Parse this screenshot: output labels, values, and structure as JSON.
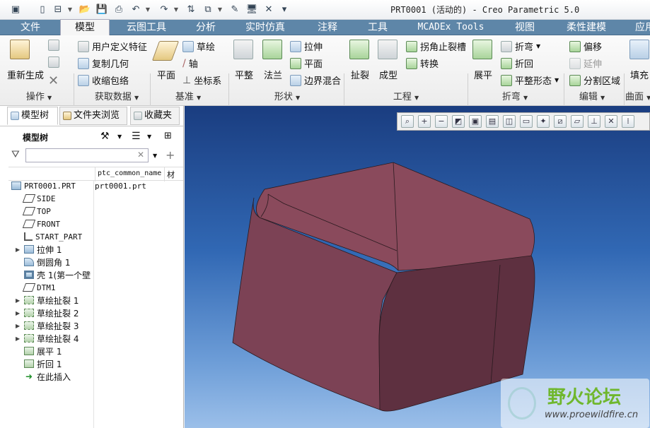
{
  "window": {
    "title": "PRT0001 (活动的) - Creo Parametric 5.0"
  },
  "quick_access": [
    "new-icon",
    "open-icon",
    "save-icon",
    "regenerate-icon",
    "undo-icon",
    "redo-icon",
    "window-icon",
    "close-icon"
  ],
  "tabs": [
    {
      "label": "文件",
      "active": false
    },
    {
      "label": "模型",
      "active": true
    },
    {
      "label": "云图工具",
      "active": false
    },
    {
      "label": "分析",
      "active": false
    },
    {
      "label": "实时仿真",
      "active": false
    },
    {
      "label": "注释",
      "active": false
    },
    {
      "label": "工具",
      "active": false
    },
    {
      "label": "MCADEx Tools",
      "active": false
    },
    {
      "label": "视图",
      "active": false
    },
    {
      "label": "柔性建模",
      "active": false
    },
    {
      "label": "应用",
      "active": false
    }
  ],
  "ribbon": {
    "operations": {
      "regenerate": "重新生成",
      "group": "操作"
    },
    "get_data": {
      "user_feature": "用户定义特征",
      "copy_geom": "复制几何",
      "shrinkwrap": "收缩包络",
      "group": "获取数据"
    },
    "datum": {
      "plane": "平面",
      "sketch": "草绘",
      "axis": "轴",
      "csys": "坐标系",
      "group": "基准"
    },
    "shapes": {
      "flat": "平整",
      "flange": "法兰",
      "extrude": "拉伸",
      "planar": "平面",
      "boundary_blend": "边界混合",
      "group": "形状"
    },
    "engineering": {
      "rip": "扯裂",
      "form": "成型",
      "corner_relief": "拐角止裂槽",
      "convert": "转换",
      "group": "工程"
    },
    "bends": {
      "unbend": "展平",
      "bend": "折弯",
      "bend_back": "折回",
      "flatten_form": "平整形态",
      "group": "折弯"
    },
    "editing": {
      "offset": "偏移",
      "extend": "延伸",
      "split_area": "分割区域",
      "group": "编辑"
    },
    "surfaces": {
      "fill": "填充",
      "group": "曲面"
    }
  },
  "left_panel": {
    "tabs": [
      "模型树",
      "文件夹浏览",
      "收藏夹"
    ],
    "title": "模型树",
    "search_placeholder": "",
    "columns": [
      "ptc_common_name",
      "材"
    ],
    "root": {
      "name": "PRT0001.PRT",
      "common_name": "prt0001.prt"
    },
    "items": [
      {
        "label": "SIDE",
        "icon": "datum-plane-icon",
        "expandable": false
      },
      {
        "label": "TOP",
        "icon": "datum-plane-icon",
        "expandable": false
      },
      {
        "label": "FRONT",
        "icon": "datum-plane-icon",
        "expandable": false
      },
      {
        "label": "START_PART",
        "icon": "csys-icon",
        "expandable": false
      },
      {
        "label": "拉伸 1",
        "icon": "extrude-icon",
        "expandable": true
      },
      {
        "label": "倒圆角 1",
        "icon": "round-icon",
        "expandable": false
      },
      {
        "label": "壳 1(第一个壁",
        "icon": "shell-icon",
        "expandable": false
      },
      {
        "label": "DTM1",
        "icon": "datum-plane-icon",
        "expandable": false
      },
      {
        "label": "草绘扯裂 1",
        "icon": "sketched-rip-icon",
        "expandable": true
      },
      {
        "label": "草绘扯裂 2",
        "icon": "sketched-rip-icon",
        "expandable": true
      },
      {
        "label": "草绘扯裂 3",
        "icon": "sketched-rip-icon",
        "expandable": true
      },
      {
        "label": "草绘扯裂 4",
        "icon": "sketched-rip-icon",
        "expandable": true
      },
      {
        "label": "展平 1",
        "icon": "unbend-icon",
        "expandable": false
      },
      {
        "label": "折回 1",
        "icon": "bend-back-icon",
        "expandable": false
      },
      {
        "label": "在此插入",
        "icon": "insert-here-icon",
        "expandable": false
      }
    ]
  },
  "viewport": {
    "toolbar": [
      "refit-icon",
      "zoom-in-icon",
      "zoom-out-icon",
      "repaint-icon",
      "display-style-icon",
      "saved-orientations-icon",
      "view-manager-icon",
      "perspective-icon",
      "spin-center-icon",
      "datum-display-icon",
      "annotation-display-icon",
      "csys-display-icon",
      "point-display-icon",
      "axis-display-icon"
    ],
    "model_color": "#8a4a5c",
    "background_top": "#1a3d80",
    "background_bottom": "#9bbfe9"
  },
  "watermark": {
    "title": "野火论坛",
    "url": "www.proewildfire.cn"
  }
}
